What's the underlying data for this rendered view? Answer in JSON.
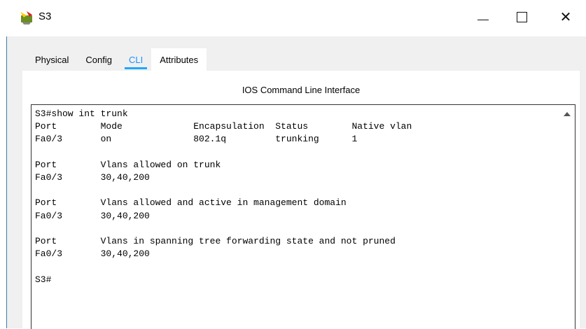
{
  "window": {
    "title": "S3",
    "minimize_glyph": "—",
    "maximize_glyph": "☐",
    "close_glyph": "✕"
  },
  "tabs": [
    {
      "label": "Physical"
    },
    {
      "label": "Config"
    },
    {
      "label": "CLI"
    },
    {
      "label": "Attributes"
    }
  ],
  "selected_tab": "CLI",
  "panel": {
    "heading": "IOS Command Line Interface"
  },
  "cli": {
    "lines": [
      "S3#show int trunk",
      "Port        Mode             Encapsulation  Status        Native vlan",
      "Fa0/3       on               802.1q         trunking      1",
      "",
      "Port        Vlans allowed on trunk",
      "Fa0/3       30,40,200",
      "",
      "Port        Vlans allowed and active in management domain",
      "Fa0/3       30,40,200",
      "",
      "Port        Vlans in spanning tree forwarding state and not pruned",
      "Fa0/3       30,40,200",
      "",
      "S3#"
    ]
  },
  "colors": {
    "accent": "#1ea7ff",
    "frame_edge": "#3c7fb1",
    "panel_bg": "#f0f0f0"
  },
  "icons": {
    "app": "packet-tracer-switch-icon",
    "scroll_up": "scroll-up-arrow-icon"
  }
}
